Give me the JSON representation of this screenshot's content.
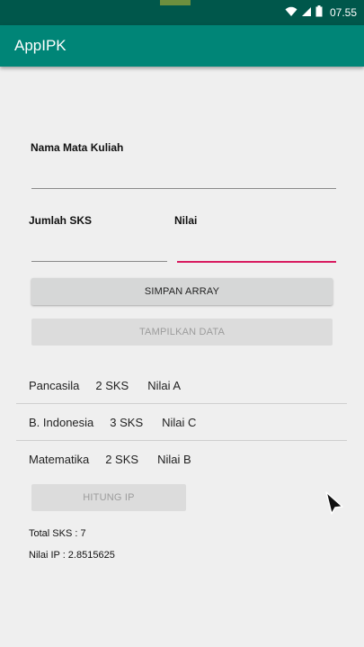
{
  "status": {
    "time": "07.55"
  },
  "app": {
    "title": "AppIPK"
  },
  "form": {
    "course_label": "Nama Mata Kuliah",
    "course_value": "",
    "sks_label": "Jumlah SKS",
    "sks_value": "",
    "grade_label": "Nilai",
    "grade_value": ""
  },
  "buttons": {
    "save": "SIMPAN ARRAY",
    "show": "TAMPILKAN DATA",
    "calc": "HITUNG IP"
  },
  "list": [
    {
      "course": "Pancasila",
      "sks": "2 SKS",
      "grade": "Nilai A"
    },
    {
      "course": "B. Indonesia",
      "sks": "3 SKS",
      "grade": "Nilai C"
    },
    {
      "course": "Matematika",
      "sks": "2 SKS",
      "grade": "Nilai B"
    }
  ],
  "summary": {
    "total_sks": "Total SKS : 7",
    "ip": "Nilai IP : 2.8515625"
  },
  "colors": {
    "accent": "#008577",
    "status": "#00574b",
    "focus": "#d81b60"
  }
}
